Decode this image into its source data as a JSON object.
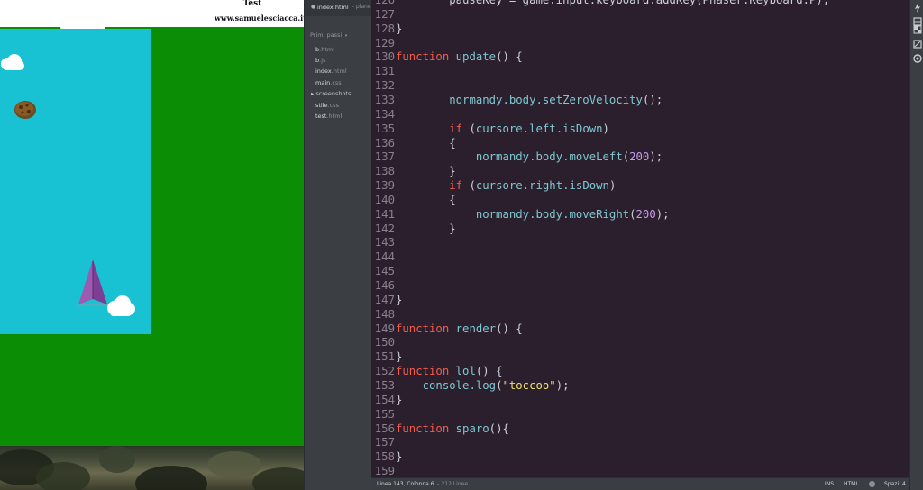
{
  "browser": {
    "page_title": "Test",
    "page_url": "www.samuelesciacca.it"
  },
  "sidebar": {
    "open_file": {
      "name": "index.html",
      "dir": "– plane"
    },
    "project": "Primi passi",
    "files": [
      {
        "base": "b",
        "ext": ".html"
      },
      {
        "base": "b",
        "ext": ".js"
      },
      {
        "base": "index",
        "ext": ".html"
      },
      {
        "base": "main",
        "ext": ".css"
      }
    ],
    "folder": "screenshots",
    "files2": [
      {
        "base": "stile",
        "ext": ".css"
      },
      {
        "base": "test",
        "ext": ".html"
      }
    ]
  },
  "code_lines": [
    {
      "n": "126",
      "tokens": [
        [
          "pl",
          "        pauseKey = game.input.keyboard.addKey(Phaser.Keyboard.P);"
        ]
      ]
    },
    {
      "n": "127",
      "tokens": []
    },
    {
      "n": "128",
      "tokens": [
        [
          "pl",
          "}"
        ]
      ]
    },
    {
      "n": "129",
      "tokens": []
    },
    {
      "n": "130",
      "tokens": [
        [
          "kw",
          "function"
        ],
        [
          "pl",
          " "
        ],
        [
          "fn",
          "update"
        ],
        [
          "pl",
          "() {"
        ]
      ]
    },
    {
      "n": "131",
      "tokens": []
    },
    {
      "n": "132",
      "tokens": []
    },
    {
      "n": "133",
      "tokens": [
        [
          "pl",
          "        "
        ],
        [
          "fn",
          "normandy.body.setZeroVelocity"
        ],
        [
          "pl",
          "();"
        ]
      ]
    },
    {
      "n": "134",
      "tokens": []
    },
    {
      "n": "135",
      "tokens": [
        [
          "pl",
          "        "
        ],
        [
          "kw",
          "if"
        ],
        [
          "pl",
          " ("
        ],
        [
          "fn",
          "cursore.left.isDown"
        ],
        [
          "pl",
          ")"
        ]
      ]
    },
    {
      "n": "136",
      "tokens": [
        [
          "pl",
          "        {"
        ]
      ]
    },
    {
      "n": "137",
      "tokens": [
        [
          "pl",
          "            "
        ],
        [
          "fn",
          "normandy.body.moveLeft"
        ],
        [
          "pl",
          "("
        ],
        [
          "num",
          "200"
        ],
        [
          "pl",
          ");"
        ]
      ]
    },
    {
      "n": "138",
      "tokens": [
        [
          "pl",
          "        }"
        ]
      ]
    },
    {
      "n": "139",
      "tokens": [
        [
          "pl",
          "        "
        ],
        [
          "kw",
          "if"
        ],
        [
          "pl",
          " ("
        ],
        [
          "fn",
          "cursore.right.isDown"
        ],
        [
          "pl",
          ")"
        ]
      ]
    },
    {
      "n": "140",
      "tokens": [
        [
          "pl",
          "        {"
        ]
      ]
    },
    {
      "n": "141",
      "tokens": [
        [
          "pl",
          "            "
        ],
        [
          "fn",
          "normandy.body.moveRight"
        ],
        [
          "pl",
          "("
        ],
        [
          "num",
          "200"
        ],
        [
          "pl",
          ");"
        ]
      ]
    },
    {
      "n": "142",
      "tokens": [
        [
          "pl",
          "        }"
        ]
      ]
    },
    {
      "n": "143",
      "tokens": []
    },
    {
      "n": "144",
      "tokens": []
    },
    {
      "n": "145",
      "tokens": []
    },
    {
      "n": "146",
      "tokens": []
    },
    {
      "n": "147",
      "tokens": [
        [
          "pl",
          "}"
        ]
      ]
    },
    {
      "n": "148",
      "tokens": []
    },
    {
      "n": "149",
      "tokens": [
        [
          "kw",
          "function"
        ],
        [
          "pl",
          " "
        ],
        [
          "fn",
          "render"
        ],
        [
          "pl",
          "() {"
        ]
      ]
    },
    {
      "n": "150",
      "tokens": []
    },
    {
      "n": "151",
      "tokens": [
        [
          "pl",
          "}"
        ]
      ]
    },
    {
      "n": "152",
      "tokens": [
        [
          "kw",
          "function"
        ],
        [
          "pl",
          " "
        ],
        [
          "fn",
          "lol"
        ],
        [
          "pl",
          "() {"
        ]
      ]
    },
    {
      "n": "153",
      "tokens": [
        [
          "pl",
          "    "
        ],
        [
          "fn",
          "console.log"
        ],
        [
          "pl",
          "("
        ],
        [
          "str",
          "\"toccoo\""
        ],
        [
          "pl",
          ");"
        ]
      ]
    },
    {
      "n": "154",
      "tokens": [
        [
          "pl",
          "}"
        ]
      ]
    },
    {
      "n": "155",
      "tokens": []
    },
    {
      "n": "156",
      "tokens": [
        [
          "kw",
          "function"
        ],
        [
          "pl",
          " "
        ],
        [
          "fn",
          "sparo"
        ],
        [
          "pl",
          "(){"
        ]
      ]
    },
    {
      "n": "157",
      "tokens": []
    },
    {
      "n": "158",
      "tokens": [
        [
          "pl",
          "}"
        ]
      ]
    },
    {
      "n": "159",
      "tokens": []
    }
  ],
  "status": {
    "position": "Linea 143, Colonna 6",
    "lines": "– 212 Linee",
    "ins": "INS",
    "lang": "HTML",
    "indent": "Spazi: 4"
  },
  "toolbar_icons": [
    "live-preview-icon",
    "extension-manager-icon",
    "layout-icon",
    "code-check-icon",
    "plugin-icon"
  ]
}
